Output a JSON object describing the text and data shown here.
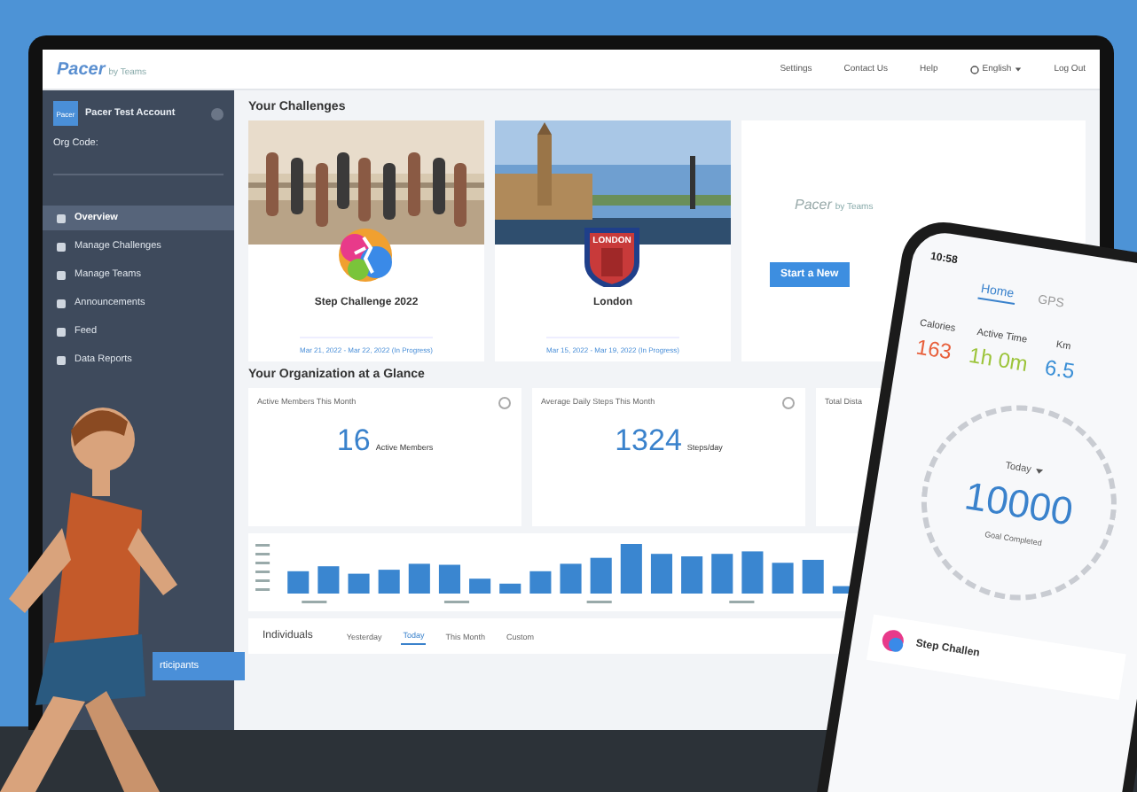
{
  "topbar": {
    "logo": "Pacer",
    "logo_suffix": "by Teams",
    "links": [
      {
        "label": "Settings"
      },
      {
        "label": "Contact Us"
      },
      {
        "label": "Help"
      },
      {
        "label": "English",
        "kind": "language"
      },
      {
        "label": "Log Out"
      }
    ]
  },
  "sidebar": {
    "account_badge": "Pacer",
    "account_name": "Pacer Test Account",
    "org_code_label": "Org Code:",
    "items": [
      {
        "label": "Overview",
        "selected": true
      },
      {
        "label": "Manage Challenges",
        "selected": false
      },
      {
        "label": "Manage Teams",
        "selected": false
      },
      {
        "label": "Announcements",
        "selected": false
      },
      {
        "label": "Feed",
        "selected": false
      },
      {
        "label": "Data Reports",
        "selected": false
      }
    ],
    "bottom_button": "rticipants"
  },
  "challenges": {
    "title": "Your Challenges",
    "cards": [
      {
        "name": "Step Challenge 2022",
        "dates": "Mar 21, 2022 - Mar 22, 2022 (In Progress)",
        "kind": "splash"
      },
      {
        "name": "London",
        "dates": "Mar 15, 2022 - Mar 19, 2022 (In Progress)",
        "kind": "shield",
        "badge_text": "LONDON"
      }
    ],
    "new_card": {
      "logo": "Pacer",
      "logo_suffix": "by Teams",
      "button": "Start a New"
    }
  },
  "glance": {
    "title": "Your Organization at a Glance",
    "stats": [
      {
        "title": "Active Members This Month",
        "value": "16",
        "unit": "Active Members"
      },
      {
        "title": "Average Daily Steps This Month",
        "value": "1324",
        "unit": "Steps/day"
      },
      {
        "title": "Total Dista"
      }
    ]
  },
  "tabs": {
    "title": "Individuals",
    "items": [
      {
        "label": "Yesterday",
        "selected": false
      },
      {
        "label": "Today",
        "selected": true
      },
      {
        "label": "This Month",
        "selected": false
      },
      {
        "label": "Custom",
        "selected": false
      }
    ]
  },
  "phone": {
    "time": "10:58",
    "tabs": [
      {
        "label": "Home",
        "selected": true
      },
      {
        "label": "GPS",
        "selected": false
      }
    ],
    "metrics": [
      {
        "label": "Calories",
        "value": "163",
        "color": "#e8603c"
      },
      {
        "label": "Active Time",
        "value": "1h 0m",
        "color": "#9cc43a"
      },
      {
        "label": "Km",
        "value": "6.5",
        "color": "#3a8fd6"
      }
    ],
    "day": "Today",
    "steps": "10000",
    "goal": "Goal Completed",
    "challenge": "Step Challen"
  }
}
